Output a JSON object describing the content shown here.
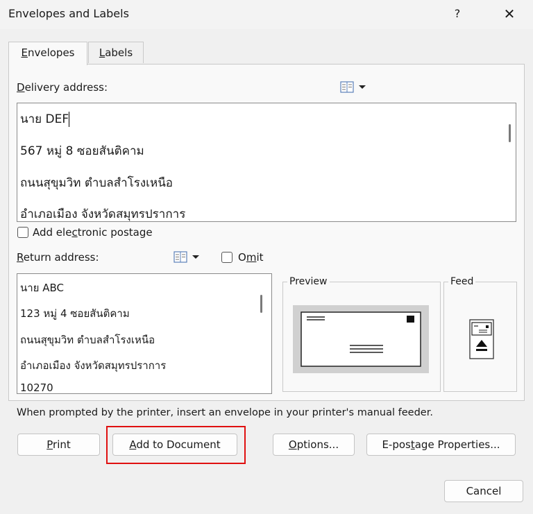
{
  "window": {
    "title": "Envelopes and Labels",
    "help_label": "?",
    "close_label": "✕"
  },
  "tabs": [
    {
      "pre": "",
      "key": "E",
      "post": "nvelopes"
    },
    {
      "pre": "",
      "key": "L",
      "post": "abels"
    }
  ],
  "delivery": {
    "label_key": "D",
    "label_rest": "elivery address:",
    "lines": [
      "นาย DEF",
      "567 หมู่ 8 ซอยสันติคาม",
      "ถนนสุขุมวิท ตำบลสำโรงเหนือ",
      "อำเภอเมือง จังหวัดสมุทรปราการ"
    ]
  },
  "electronic_postage": {
    "pre": "Add ele",
    "key": "c",
    "post": "tronic postage",
    "checked": false
  },
  "return": {
    "label_key": "R",
    "label_rest": "eturn address:",
    "omit_pre": "O",
    "omit_key": "m",
    "omit_post": "it",
    "omit_checked": false,
    "lines": [
      "นาย ABC",
      "123 หมู่ 4 ซอยสันติคาม",
      "ถนนสุขุมวิท ตำบลสำโรงเหนือ",
      "อำเภอเมือง จังหวัดสมุทรปราการ",
      "10270"
    ]
  },
  "preview_title": "Preview",
  "feed_title": "Feed",
  "hint": "When prompted by the printer, insert an envelope in your printer's manual feeder.",
  "buttons": {
    "print_key": "P",
    "print_rest": "rint",
    "add_key": "A",
    "add_rest": "dd to Document",
    "options_key": "O",
    "options_rest": "ptions...",
    "epostage_pre": "E-pos",
    "epostage_key": "t",
    "epostage_post": "age Properties...",
    "cancel": "Cancel"
  },
  "icons": {
    "address_book": "address-book-icon",
    "dropdown": "dropdown-arrow-icon"
  }
}
